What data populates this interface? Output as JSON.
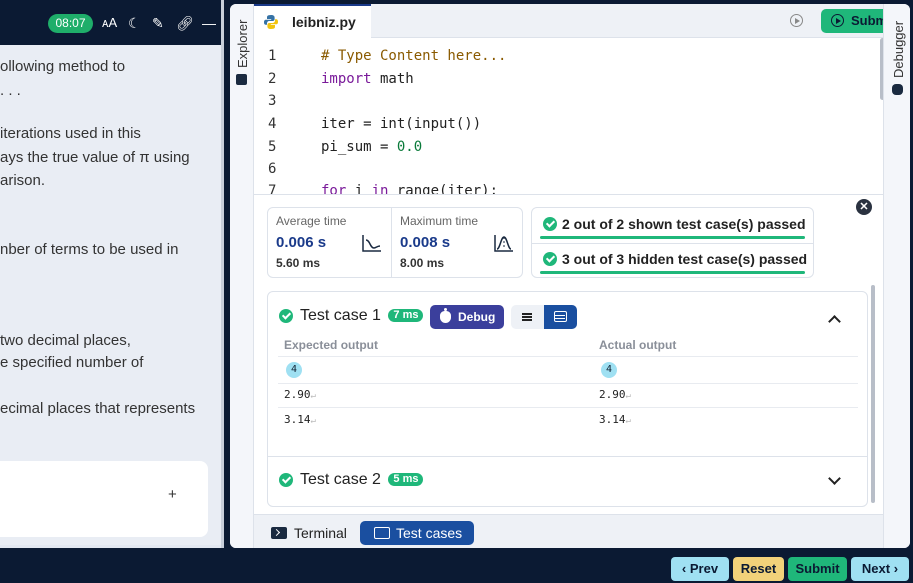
{
  "header": {
    "timer": "08:07"
  },
  "problem": {
    "lines": [
      "ollowing method to",
      ". . .",
      "iterations used in this",
      "ays the true value of π using",
      "arison.",
      "nber of terms to be used in",
      " two decimal places,",
      "e specified number of",
      "ecimal places that represents"
    ],
    "add_label": "+"
  },
  "rails": {
    "explorer": "Explorer",
    "debugger": "Debugger"
  },
  "editor": {
    "file_name": "leibniz.py",
    "submit_label": "Submit",
    "line_numbers": [
      "1",
      "2",
      "3",
      "4",
      "5",
      "6",
      "7"
    ]
  },
  "stats": {
    "avg_label": "Average time",
    "avg_value": "0.006 s",
    "avg_sub": "5.60 ms",
    "max_label": "Maximum time",
    "max_value": "0.008 s",
    "max_sub": "8.00 ms"
  },
  "summary": {
    "shown": "2 out of 2 shown test case(s) passed",
    "hidden": "3 out of 3 hidden test case(s) passed"
  },
  "case1": {
    "title": "Test case 1",
    "time": "7 ms",
    "debug_label": "Debug",
    "expected_header": "Expected output",
    "actual_header": "Actual output",
    "expected": [
      "4",
      "2.90",
      "3.14"
    ],
    "actual": [
      "4",
      "2.90",
      "3.14"
    ]
  },
  "case2": {
    "title": "Test case 2",
    "time": "5 ms"
  },
  "bottom_tabs": {
    "terminal": "Terminal",
    "test_cases": "Test cases"
  },
  "nav": {
    "prev": "Prev",
    "reset": "Reset",
    "submit": "Submit",
    "next": "Next"
  },
  "colors": {
    "accent": "#1fb77a",
    "primary": "#1a4fa0",
    "navy": "#0b1a33",
    "debug": "#3b3f9c"
  }
}
